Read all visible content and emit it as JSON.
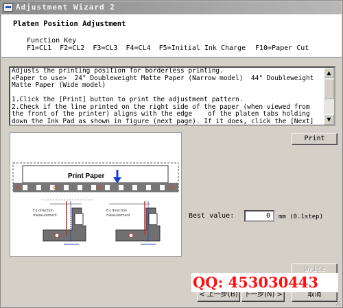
{
  "window": {
    "title": "Adjustment Wizard 2"
  },
  "header": {
    "title": "Platen Position Adjustment",
    "function_key_label": "Function Key",
    "function_keys_line": "F1=CL1  F2=CL2  F3=CL3  F4=CL4  F5=Initial Ink Charge",
    "paper_cut_key": "F10=Paper Cut"
  },
  "description": {
    "text": "Adjusts the printing position for borderless printing.\n<Paper to use>  24\" Doubleweight Matte Paper (Narrow model)  44\" Doubleweight Matte Paper (Wide model)\n\n1.Click the [Print] button to print the adjustment pattern.\n2.Check if the line printed on the right side of the paper (when viewed from the front of the printer) aligns with the edge    of the platen tabs holding down the Ink Pad as shown in figure (next page). If it does, click the [Next] button to     proceed  to the"
  },
  "figure": {
    "print_paper_label": "Print Paper",
    "measure_label_1_line1": "F-J direction",
    "measure_label_1_line2": "measurement",
    "measure_label_2_line1": "E-J direction",
    "measure_label_2_line2": "measurement"
  },
  "buttons": {
    "print": "Print",
    "write": "Write",
    "back": "< 上一步(B)",
    "next": "下一步(N) >",
    "cancel": "取消"
  },
  "best_value": {
    "label": "Best value:",
    "value": "0",
    "unit": "mm (0.1step)"
  },
  "watermark": {
    "text": "QQ: 453030443",
    "color": "#ff1010"
  },
  "colors": {
    "accent_arrow": "#1a3fd0",
    "red_line": "#e02020"
  }
}
